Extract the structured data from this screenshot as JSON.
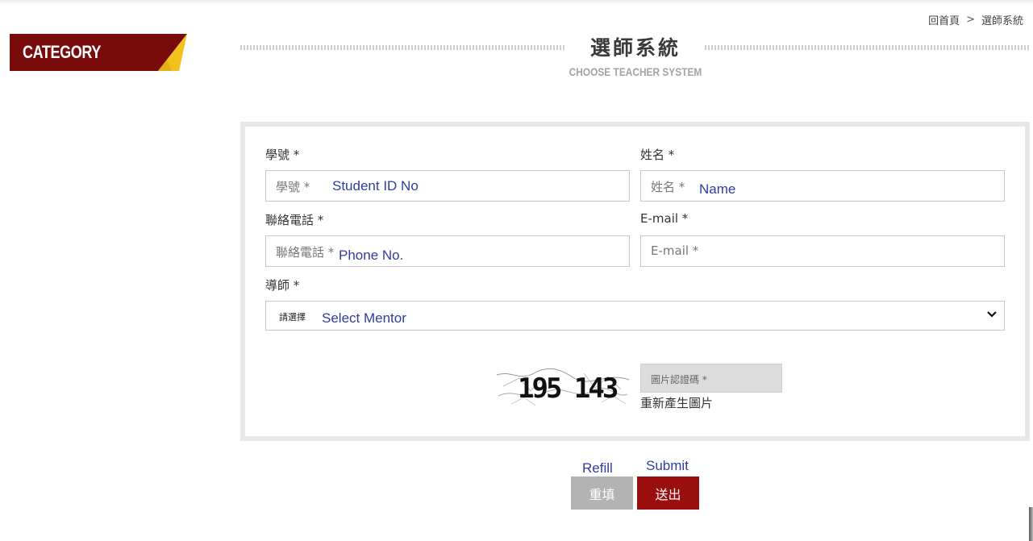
{
  "breadcrumb": {
    "home": "回首頁",
    "separator": ">",
    "current": "選師系統"
  },
  "sidebar": {
    "category_label": "CATEGORY",
    "colors": {
      "primary": "#7a0b0b",
      "accent": "#f2c21b"
    }
  },
  "header": {
    "title": "選師系統",
    "subtitle": "CHOOSE TEACHER SYSTEM"
  },
  "form": {
    "student_id": {
      "label": "學號 *",
      "placeholder": "學號 *",
      "annotation": "Student ID No"
    },
    "name": {
      "label": "姓名 *",
      "placeholder": "姓名 *",
      "annotation": "Name"
    },
    "phone": {
      "label": "聯絡電話 *",
      "placeholder": "聯絡電話 *",
      "annotation": "Phone No."
    },
    "email": {
      "label": "E-mail *",
      "placeholder": "E-mail *"
    },
    "mentor": {
      "label": "導師 *",
      "selected": "請選擇",
      "annotation": "Select Mentor"
    },
    "captcha": {
      "code": "195 143",
      "placeholder": "圖片認證碼 *",
      "regenerate": "重新產生圖片"
    }
  },
  "buttons": {
    "reset": {
      "label": "重填",
      "annotation": "Refill"
    },
    "submit": {
      "label": "送出",
      "annotation": "Submit"
    }
  },
  "icons": {
    "select_arrow": "chevron-down-icon"
  }
}
